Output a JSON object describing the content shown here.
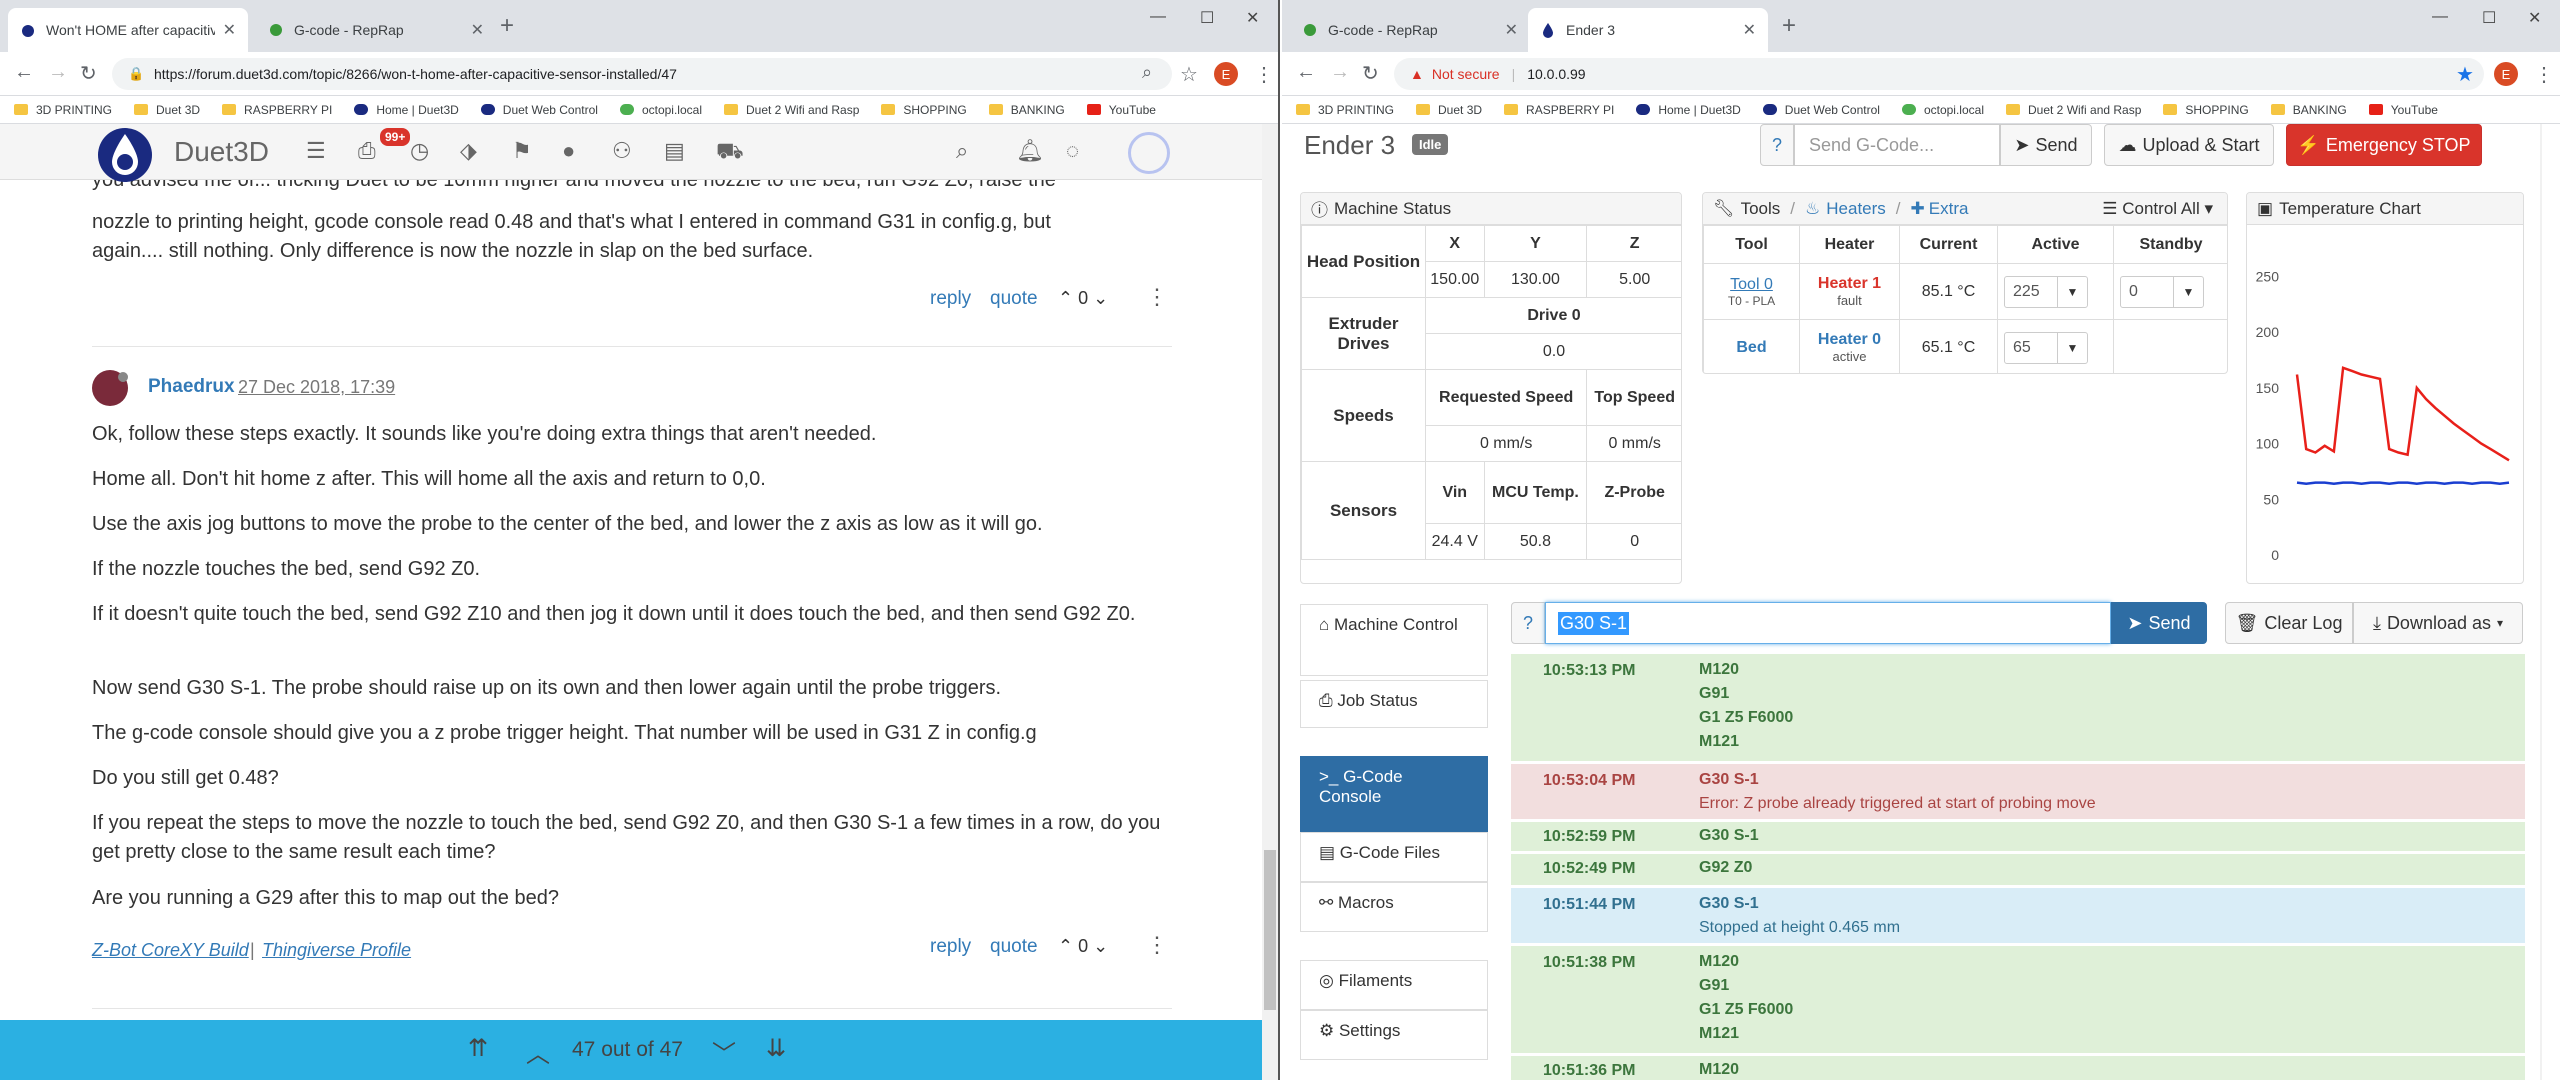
{
  "left": {
    "tabs": [
      {
        "title": "Won't HOME after capacitive sen"
      },
      {
        "title": "G-code - RepRap"
      }
    ],
    "url": "https://forum.duet3d.com/topic/8266/won-t-home-after-capacitive-sensor-installed/47",
    "bookmarks": [
      "3D PRINTING",
      "Duet 3D",
      "RASPBERRY PI",
      "Home | Duet3D",
      "Duet Web Control",
      "octopi.local",
      "Duet 2 Wifi and Rasp",
      "SHOPPING",
      "BANKING",
      "YouTube"
    ],
    "profile_letter": "E",
    "forum": {
      "site_name": "Duet3D",
      "notif_count": "99+",
      "prev_post": {
        "lines": [
          "you advised me of... tricking Duet to be 10mm higher and moved the nozzle to the bed, run G92 Z0, raise the",
          "nozzle to printing height, gcode console read 0.48 and that's what I entered in command G31 in config.g, but",
          "again.... still nothing. Only difference is now the nozzle in slap on the bed surface."
        ],
        "reply": "reply",
        "quote": "quote",
        "votes": "0"
      },
      "post": {
        "author": "Phaedrux",
        "time": "27 Dec 2018, 17:39",
        "paragraphs": [
          "Ok, follow these steps exactly. It sounds like you're doing extra things that aren't needed.",
          "Home all. Don't hit home z after. This will home all the axis and return to 0,0.",
          "Use the axis jog buttons to move the probe to the center of the bed, and lower the z axis as low as it will go.",
          "If the nozzle touches the bed, send G92 Z0.",
          "If it doesn't quite touch the bed, send G92 Z10 and then jog it down until it does touch the bed, and then send G92 Z0.",
          "Now send G30 S-1. The probe should raise up on its own and then lower again until the probe triggers.",
          "The g-code console should give you a z probe trigger height. That number will be used in G31 Z in config.g",
          "Do you still get 0.48?",
          "If you repeat the steps to move the nozzle to touch the bed, send G92 Z0, and then G30 S-1 a few times in a row, do you get pretty close to the same result each time?",
          "Are you running a G29 after this to map out the bed?"
        ],
        "sig_link1": "Z-Bot CoreXY Build",
        "sig_sep": "|",
        "sig_link2": "Thingiverse Profile",
        "reply": "reply",
        "quote": "quote",
        "votes": "0"
      },
      "pagination": "47 out of 47"
    }
  },
  "right": {
    "tabs": [
      {
        "title": "G-code - RepRap"
      },
      {
        "title": "Ender 3"
      }
    ],
    "not_secure": "Not secure",
    "url": "10.0.0.99",
    "bookmarks": [
      "3D PRINTING",
      "Duet 3D",
      "RASPBERRY PI",
      "Home | Duet3D",
      "Duet Web Control",
      "octopi.local",
      "Duet 2 Wifi and Rasp",
      "SHOPPING",
      "BANKING",
      "YouTube"
    ],
    "profile_letter": "E",
    "dwc": {
      "printer_name": "Ender 3",
      "status": "Idle",
      "gcode_placeholder": "Send G-Code...",
      "help": "?",
      "send": "Send",
      "upload_start": "Upload & Start",
      "estop": "Emergency STOP",
      "machine_status": {
        "title": "Machine Status",
        "head_position": "Head Position",
        "axes": [
          "X",
          "Y",
          "Z"
        ],
        "positions": [
          "150.00",
          "130.00",
          "5.00"
        ],
        "extruder_drives": "Extruder Drives",
        "drive0": "Drive 0",
        "drive0_val": "0.0",
        "speeds": "Speeds",
        "requested_speed": "Requested Speed",
        "top_speed": "Top Speed",
        "req_val": "0 mm/s",
        "top_val": "0 mm/s",
        "sensors": "Sensors",
        "vin": "Vin",
        "mcu_temp": "MCU Temp.",
        "zprobe": "Z-Probe",
        "vin_val": "24.4 V",
        "mcu_val": "50.8",
        "zprobe_val": "0"
      },
      "tools": {
        "title_tools": "Tools",
        "title_heaters": "Heaters",
        "title_extra": "Extra",
        "control_all": "Control All",
        "headers": [
          "Tool",
          "Heater",
          "Current",
          "Active",
          "Standby"
        ],
        "rows": [
          {
            "tool": "Tool 0",
            "tool_sub": "T0 - PLA",
            "heater": "Heater 1",
            "heater_state": "fault",
            "current": "85.1 °C",
            "active": "225",
            "standby": "0"
          },
          {
            "tool": "Bed",
            "tool_sub": "",
            "heater": "Heater 0",
            "heater_state": "active",
            "current": "65.1 °C",
            "active": "65",
            "standby": ""
          }
        ]
      },
      "temp_chart": {
        "title": "Temperature Chart"
      },
      "chart_data": {
        "type": "line",
        "title": "Temperature Chart",
        "ylim": [
          0,
          280
        ],
        "yticks": [
          0,
          50,
          100,
          150,
          200,
          250
        ],
        "series": [
          {
            "color": "#e8201a",
            "values": [
              162,
              95,
              92,
              98,
              93,
              168,
              165,
              162,
              160,
              158,
              95,
              92,
              90,
              150,
              140,
              132,
              125,
              118,
              112,
              106,
              100,
              95,
              90,
              85
            ]
          },
          {
            "color": "#1a3ed0",
            "values": [
              65,
              64,
              65,
              65,
              64,
              65,
              65,
              64,
              65,
              65,
              64,
              65,
              65,
              64,
              65,
              65,
              64,
              65,
              65,
              64,
              65,
              65,
              64,
              65
            ]
          }
        ]
      },
      "nav": [
        "Machine Control",
        "Job Status",
        "G-Code Console",
        "G-Code Files",
        "Macros",
        "Filaments",
        "Settings"
      ],
      "console": {
        "help": "?",
        "input_value": "G30 S-1",
        "send": "Send",
        "clear_log": "Clear Log",
        "download_as": "Download as",
        "entries": [
          {
            "time": "10:53:13 PM",
            "lines": [
              "M120",
              "G91",
              "G1 Z5 F6000",
              "M121"
            ],
            "kind": "green"
          },
          {
            "time": "10:53:04 PM",
            "lines": [
              "G30 S-1",
              "Error: Z probe already triggered at start of probing move"
            ],
            "kind": "red"
          },
          {
            "time": "10:52:59 PM",
            "lines": [
              "G30 S-1"
            ],
            "kind": "green"
          },
          {
            "time": "10:52:49 PM",
            "lines": [
              "G92 Z0"
            ],
            "kind": "green"
          },
          {
            "time": "10:51:44 PM",
            "lines": [
              "G30 S-1",
              "Stopped at height 0.465 mm"
            ],
            "kind": "blue"
          },
          {
            "time": "10:51:38 PM",
            "lines": [
              "M120",
              "G91",
              "G1 Z5 F6000",
              "M121"
            ],
            "kind": "green"
          },
          {
            "time": "10:51:36 PM",
            "lines": [
              "M120"
            ],
            "kind": "green"
          }
        ]
      }
    }
  }
}
